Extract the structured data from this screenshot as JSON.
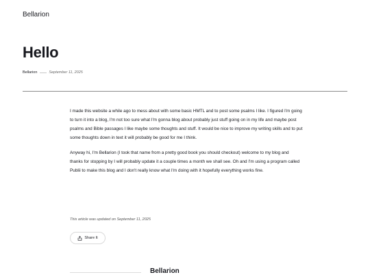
{
  "header": {
    "site_title": "Bellarion"
  },
  "post": {
    "title": "Hello",
    "author": "Bellarion",
    "date": "September 11, 2025",
    "paragraphs": [
      "I made this website a while ago to mess about with some basic HMTL and to post some psalms I like. I figured I'm going to turn it into a blog, I'm not too sure what I'm gonna blog about probably just stuff going on in my life and maybe post psalms and Bible passages I like maybe some thoughts and stuff. It would be nice to improve my writing skills and to put some thoughts down in text it will probably be good for me I think.",
      "Anyway hi, I'm Bellarion (I took that name from a pretty good book you should checkout) welcome to my blog and thanks for stopping by I will probably update it a couple times a month we shall see. Oh and I'm using a program called Publii to make this blog and I don't really know what I'm doing with it hopefully everything works fine."
    ],
    "updated_text": "This article was updated on September 11, 2025",
    "share_label": "Share It"
  },
  "author_box": {
    "name": "Bellarion"
  },
  "icons": {
    "share": "share-icon"
  }
}
